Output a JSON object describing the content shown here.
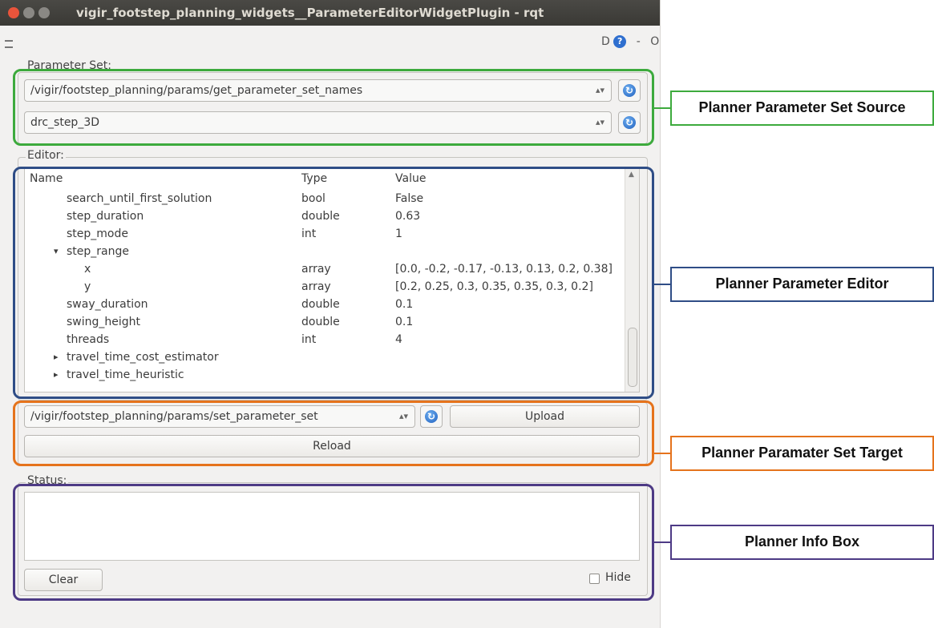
{
  "window": {
    "title": "vigir_footstep_planning_widgets__ParameterEditorWidgetPlugin - rqt",
    "dock_controls": {
      "d": "D",
      "help": "?",
      "minimize": "-",
      "close": "O"
    }
  },
  "parameter_set": {
    "label": "Parameter Set:",
    "source_service": "/vigir/footstep_planning/params/get_parameter_set_names",
    "selected_set": "drc_step_3D"
  },
  "editor": {
    "label": "Editor:",
    "columns": {
      "name": "Name",
      "type": "Type",
      "value": "Value"
    },
    "rows": [
      {
        "expander": "",
        "name": "search_until_first_solution",
        "type": "bool",
        "value": "False"
      },
      {
        "expander": "",
        "name": "step_duration",
        "type": "double",
        "value": "0.63"
      },
      {
        "expander": "",
        "name": "step_mode",
        "type": "int",
        "value": "1"
      },
      {
        "expander": "▾",
        "name": "step_range",
        "type": "",
        "value": ""
      },
      {
        "expander": "",
        "name": "x",
        "type": "array",
        "value": "[0.0, -0.2, -0.17, -0.13, 0.13, 0.2, 0.38]"
      },
      {
        "expander": "",
        "name": "y",
        "type": "array",
        "value": "[0.2, 0.25, 0.3, 0.35, 0.35, 0.3, 0.2]"
      },
      {
        "expander": "",
        "name": "sway_duration",
        "type": "double",
        "value": "0.1"
      },
      {
        "expander": "",
        "name": "swing_height",
        "type": "double",
        "value": "0.1"
      },
      {
        "expander": "",
        "name": "threads",
        "type": "int",
        "value": "4"
      },
      {
        "expander": "▸",
        "name": "travel_time_cost_estimator",
        "type": "",
        "value": ""
      },
      {
        "expander": "▸",
        "name": "travel_time_heuristic",
        "type": "",
        "value": ""
      }
    ]
  },
  "target": {
    "service": "/vigir/footstep_planning/params/set_parameter_set",
    "upload_label": "Upload",
    "reload_label": "Reload"
  },
  "status": {
    "label": "Status:",
    "text": "",
    "clear_label": "Clear",
    "hide_label": "Hide",
    "hide_checked": false
  },
  "annotations": {
    "source": "Planner Parameter Set Source",
    "editor": "Planner Parameter Editor",
    "target": "Planner Paramater Set Target",
    "info": "Planner Info Box"
  },
  "colors": {
    "source": "#3daa3d",
    "editor": "#2f4d86",
    "target": "#e5731c",
    "info": "#4d3a85"
  }
}
